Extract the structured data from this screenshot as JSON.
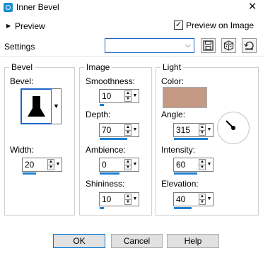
{
  "window": {
    "title": "Inner Bevel",
    "close_glyph": "✕",
    "icon": "app-icon"
  },
  "preview": {
    "toggle_glyph": "▶",
    "label": "Preview",
    "preview_on_image_label": "Preview on Image",
    "preview_on_image_checked": true,
    "check_glyph": "✓"
  },
  "settings": {
    "label": "Settings",
    "value": "",
    "chevron": "⌵",
    "buttons": [
      "save-icon",
      "random-dice-icon",
      "reset-icon"
    ]
  },
  "bevel": {
    "title": "Bevel",
    "bevel_label": "Bevel:",
    "dropdown_glyph": "▼",
    "width_label": "Width:",
    "width_value": "20",
    "width_fraction": 0.35
  },
  "image": {
    "title": "Image",
    "smoothness_label": "Smoothness:",
    "smoothness_value": "10",
    "smoothness_fraction": 0.1,
    "depth_label": "Depth:",
    "depth_value": "70",
    "depth_fraction": 0.7,
    "ambience_label": "Ambience:",
    "ambience_value": "0",
    "ambience_fraction": 0.5,
    "shininess_label": "Shininess:",
    "shininess_value": "10",
    "shininess_fraction": 0.1
  },
  "light": {
    "title": "Light",
    "color_label": "Color:",
    "color": "#c49a84",
    "angle_label": "Angle:",
    "angle_value": "315",
    "angle_fraction": 0.875,
    "intensity_label": "Intensity:",
    "intensity_value": "60",
    "intensity_fraction": 0.6,
    "elevation_label": "Elevation:",
    "elevation_value": "40",
    "elevation_fraction": 0.45
  },
  "buttons": {
    "ok": "OK",
    "cancel": "Cancel",
    "help": "Help"
  },
  "arrows": {
    "up": "▲",
    "down": "▼"
  }
}
